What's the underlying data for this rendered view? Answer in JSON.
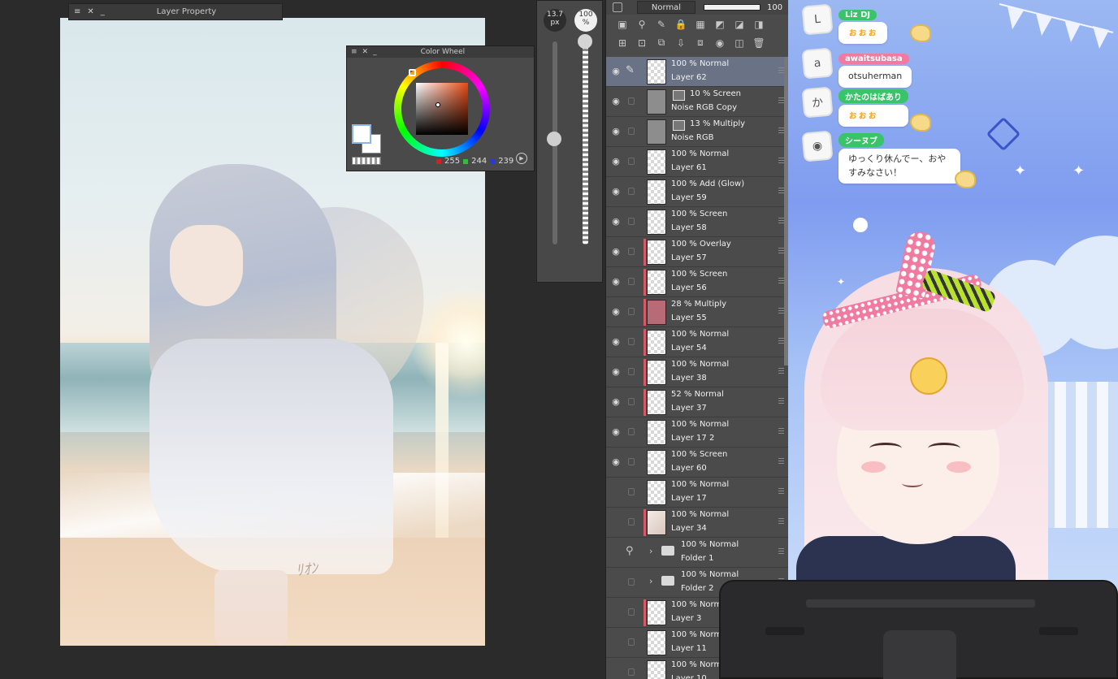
{
  "layer_property": {
    "title": "Layer Property"
  },
  "color_wheel": {
    "title": "Color Wheel",
    "r": "255",
    "g": "244",
    "b": "239",
    "main_color": "#ffffff",
    "sub_color": "#ffffff"
  },
  "brush": {
    "size_value": "13.7",
    "size_unit": "px",
    "opacity_value": "100",
    "opacity_unit": "%",
    "size_level": 0.52,
    "opacity_level": 1.0
  },
  "layer_panel": {
    "blend_mode": "Normal",
    "opacity": "100",
    "layers": [
      {
        "mode": "100 % Normal",
        "name": "Layer 62",
        "visible": true,
        "selected": true,
        "editing": true,
        "thumb": "checker"
      },
      {
        "mode": "10 % Screen",
        "name": "Noise RGB Copy",
        "visible": true,
        "fx": true,
        "thumb": "dark"
      },
      {
        "mode": "13 % Multiply",
        "name": "Noise RGB",
        "visible": true,
        "fx": true,
        "thumb": "dark"
      },
      {
        "mode": "100 % Normal",
        "name": "Layer 61",
        "visible": true,
        "thumb": "checker"
      },
      {
        "mode": "100 % Add (Glow)",
        "name": "Layer 59",
        "visible": true,
        "thumb": "checker"
      },
      {
        "mode": "100 % Screen",
        "name": "Layer 58",
        "visible": true,
        "thumb": "checker"
      },
      {
        "mode": "100 % Overlay",
        "name": "Layer 57",
        "visible": true,
        "clip": true,
        "thumb": "checker"
      },
      {
        "mode": "100 % Screen",
        "name": "Layer 56",
        "visible": true,
        "clip": true,
        "thumb": "checker"
      },
      {
        "mode": "28 % Multiply",
        "name": "Layer 55",
        "visible": true,
        "clip": true,
        "thumb": "pink"
      },
      {
        "mode": "100 % Normal",
        "name": "Layer 54",
        "visible": true,
        "clip": true,
        "thumb": "checker"
      },
      {
        "mode": "100 % Normal",
        "name": "Layer 38",
        "visible": true,
        "clip": true,
        "thumb": "checker"
      },
      {
        "mode": "52 % Normal",
        "name": "Layer 37",
        "visible": true,
        "clip": true,
        "thumb": "checker"
      },
      {
        "mode": "100 % Normal",
        "name": "Layer 17 2",
        "visible": true,
        "thumb": "checker"
      },
      {
        "mode": "100 % Screen",
        "name": "Layer 60",
        "visible": true,
        "thumb": "checker"
      },
      {
        "mode": "100 % Normal",
        "name": "Layer 17",
        "visible": false,
        "thumb": "checker"
      },
      {
        "mode": "100 % Normal",
        "name": "Layer 34",
        "visible": false,
        "clip": true,
        "thumb": "sketch"
      },
      {
        "mode": "100 % Normal",
        "name": "Folder 1",
        "visible": false,
        "folder": true,
        "folder_link": true
      },
      {
        "mode": "100 % Normal",
        "name": "Folder 2",
        "visible": false,
        "folder": true
      },
      {
        "mode": "100 % Normal",
        "name": "Layer 3",
        "visible": false,
        "clip": true,
        "thumb": "checker"
      },
      {
        "mode": "100 % Normal",
        "name": "Layer 11",
        "visible": false,
        "thumb": "checker"
      },
      {
        "mode": "100 % Normal",
        "name": "Layer 10",
        "visible": false,
        "thumb": "checker"
      }
    ]
  },
  "chat": {
    "messages": [
      {
        "user": "Liz DJ",
        "name_color": "#39c46a",
        "text": "ぉぉぉ",
        "avatar": "L"
      },
      {
        "user": "awaitsubasa",
        "name_color": "#f07aa0",
        "text": "otsuherman",
        "avatar": "a"
      },
      {
        "user": "かたのはばあり",
        "name_color": "#39c46a",
        "text": "ぉぉぉ",
        "avatar": "か"
      },
      {
        "user": "シーヌブ",
        "name_color": "#39c46a",
        "text": "ゆっくり休んでー、おやすみなさい！",
        "avatar": "◉"
      }
    ]
  },
  "canvas": {
    "signature": "ﾘｵﾝ"
  }
}
